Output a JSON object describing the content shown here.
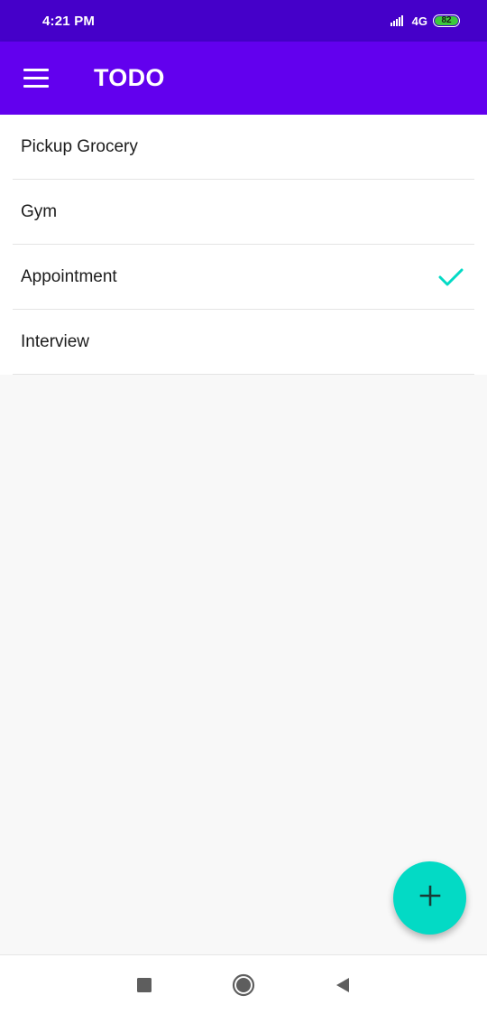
{
  "status_bar": {
    "time": "4:21 PM",
    "network": "4G",
    "battery_level": "82",
    "battery_color": "#3cc93c",
    "background": "#4500c9"
  },
  "app_bar": {
    "title": "TODO",
    "menu_icon": "hamburger-menu-icon",
    "background": "#6200ee"
  },
  "todos": [
    {
      "label": "Pickup Grocery",
      "done": false
    },
    {
      "label": "Gym",
      "done": false
    },
    {
      "label": "Appointment",
      "done": true
    },
    {
      "label": "Interview",
      "done": false
    }
  ],
  "fab": {
    "icon": "plus-icon",
    "color": "#03dac5"
  },
  "nav_bar": {
    "items": [
      {
        "icon": "recents-square-icon"
      },
      {
        "icon": "home-circle-icon"
      },
      {
        "icon": "back-triangle-icon"
      }
    ]
  },
  "colors": {
    "accent_check": "#03dac5"
  }
}
